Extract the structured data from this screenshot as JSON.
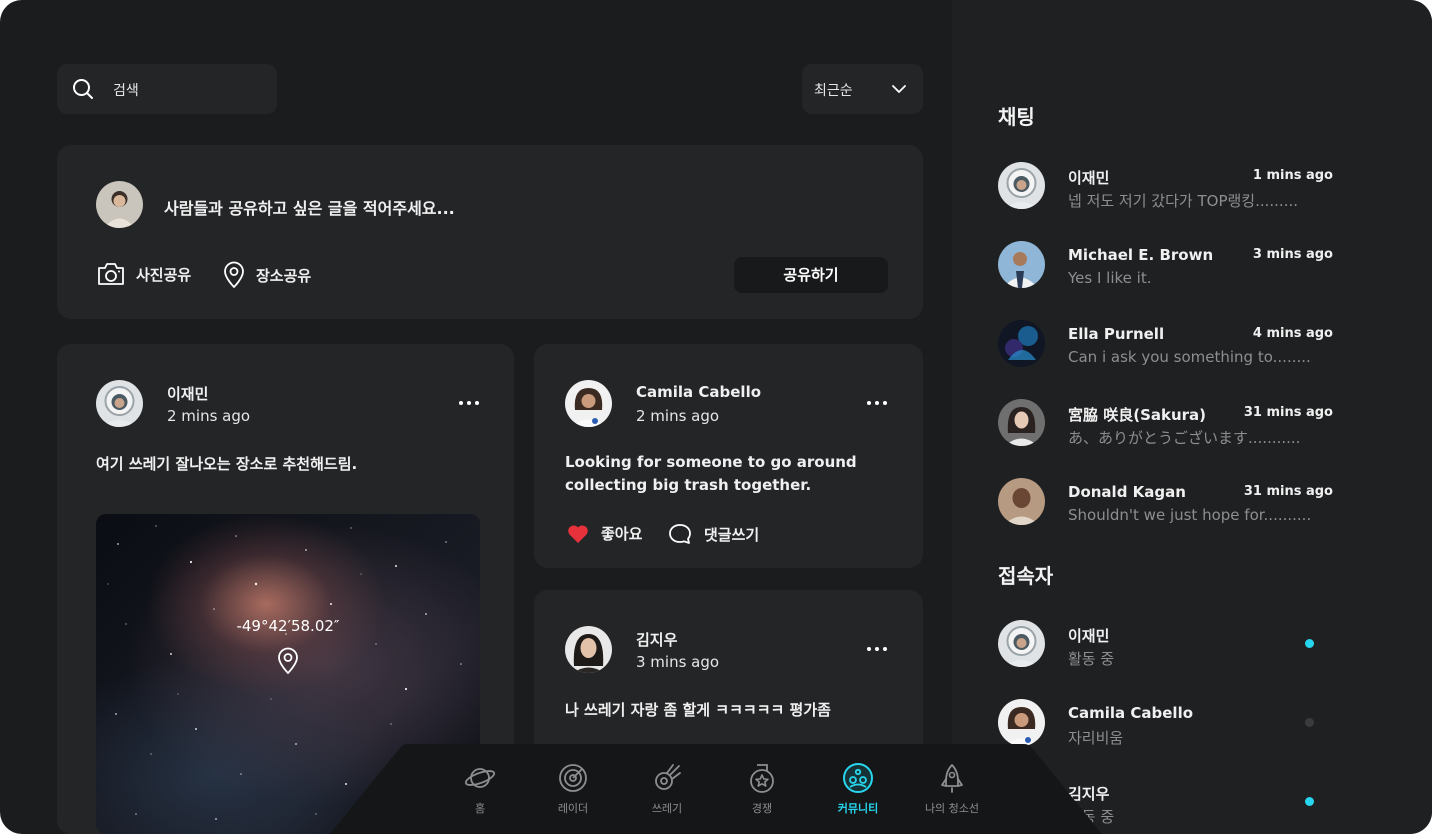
{
  "search": {
    "label": "검색"
  },
  "sort": {
    "selected": "최근순"
  },
  "composer": {
    "prompt": "사람들과 공유하고 싶은 글을 적어주세요...",
    "photo_label": "사진공유",
    "place_label": "장소공유",
    "share_label": "공유하기"
  },
  "posts": [
    {
      "author": "이재민",
      "time": "2 mins ago",
      "text": "여기 쓰레기 잘나오는 장소로 추천해드림.",
      "coordinate": "-49°42′58.02″"
    },
    {
      "author": "Camila Cabello",
      "time": "2 mins ago",
      "text": "Looking for someone to go around collecting big trash together.",
      "like_label": "좋아요",
      "comment_label": "댓글쓰기"
    },
    {
      "author": "김지우",
      "time": "3 mins ago",
      "text": "나 쓰레기 자랑 좀 할게 ㅋㅋㅋㅋㅋ 평가좀"
    }
  ],
  "chat": {
    "title": "채팅",
    "items": [
      {
        "name": "이재민",
        "time": "1 mins ago",
        "message": "넵 저도 저기 갔다가 TOP랭킹........."
      },
      {
        "name": "Michael E. Brown",
        "time": "3 mins ago",
        "message": "Yes I like it."
      },
      {
        "name": "Ella Purnell",
        "time": "4 mins ago",
        "message": "Can i ask you something to........"
      },
      {
        "name": "宮脇 咲良(Sakura)",
        "time": "31 mins ago",
        "message": "あ、ありがとうございます..........."
      },
      {
        "name": "Donald Kagan",
        "time": "31 mins ago",
        "message": "Shouldn't we just hope for.........."
      }
    ]
  },
  "online": {
    "title": "접속자",
    "items": [
      {
        "name": "이재민",
        "status": "활동 중",
        "dot_color": "#27d6ee"
      },
      {
        "name": "Camila Cabello",
        "status": "자리비움",
        "dot_color": "#3a3b3d"
      },
      {
        "name": "김지우",
        "status": "활동 중",
        "dot_color": "#27d6ee"
      }
    ]
  },
  "nav": {
    "items": [
      {
        "label": "홈",
        "icon": "planet-icon"
      },
      {
        "label": "레이더",
        "icon": "radar-icon"
      },
      {
        "label": "쓰레기",
        "icon": "comet-icon"
      },
      {
        "label": "경쟁",
        "icon": "medal-icon"
      },
      {
        "label": "커뮤니티",
        "icon": "community-icon",
        "active": true
      },
      {
        "label": "나의 청소선",
        "icon": "rocket-icon"
      }
    ]
  },
  "colors": {
    "accent": "#27d6ee",
    "like": "#e8323b",
    "background": "#1b1c1e",
    "card": "#242527"
  }
}
